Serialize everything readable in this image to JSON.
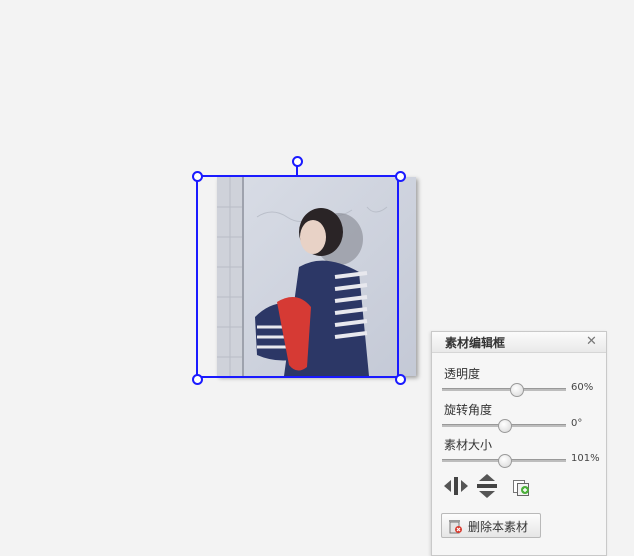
{
  "editor": {
    "photo": {
      "description_icon": "photo-thumbnail"
    },
    "selection": {
      "handles": [
        "top-left",
        "top-right",
        "bottom-left",
        "bottom-right",
        "rotate"
      ]
    }
  },
  "panel": {
    "title": "素材编辑框",
    "close_label": "✕",
    "opacity": {
      "label": "透明度",
      "value_text": "60%",
      "value": 60,
      "min": 0,
      "max": 100
    },
    "rotation": {
      "label": "旋转角度",
      "value_text": "0°",
      "value": 0,
      "min": -180,
      "max": 180
    },
    "size": {
      "label": "素材大小",
      "value_text": "101%",
      "value": 101,
      "min": 1,
      "max": 201
    },
    "tools": {
      "flip_horizontal_icon": "flip-horizontal-icon",
      "flip_vertical_icon": "flip-vertical-icon",
      "copy_icon": "copy-icon"
    },
    "delete_label": "删除本素材"
  },
  "colors": {
    "selection": "#1a1aff",
    "panel_bg": "#f6f6f6",
    "canvas_bg": "#f3f3f3"
  }
}
